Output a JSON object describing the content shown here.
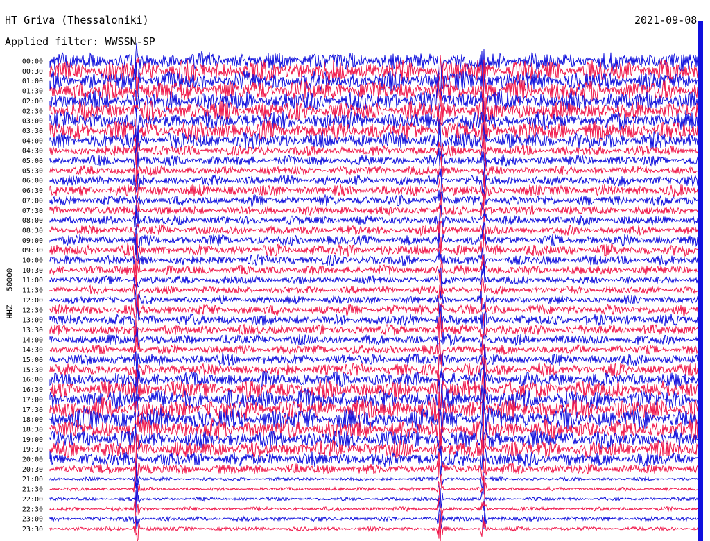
{
  "header": {
    "station": "HT Griva (Thessaloniki)",
    "date": "2021-09-08",
    "filter": "Applied filter: WWSSN-SP"
  },
  "channel_label": "HHZ - 50000",
  "colors": {
    "trace_a": "#1010dd",
    "trace_b": "#f0174a",
    "text": "#000000",
    "background": "#ffffff"
  },
  "chart_data": {
    "type": "line",
    "title": "HT Griva (Thessaloniki)",
    "ylabel": "HHZ - 50000",
    "xlabel": "",
    "rows": [
      "00:00",
      "00:30",
      "01:00",
      "01:30",
      "02:00",
      "02:30",
      "03:00",
      "03:30",
      "04:00",
      "04:30",
      "05:00",
      "05:30",
      "06:00",
      "06:30",
      "07:00",
      "07:30",
      "08:00",
      "08:30",
      "09:00",
      "09:30",
      "10:00",
      "10:30",
      "11:00",
      "11:30",
      "12:00",
      "12:30",
      "13:00",
      "13:30",
      "14:00",
      "14:30",
      "15:00",
      "15:30",
      "16:00",
      "16:30",
      "17:00",
      "17:30",
      "18:00",
      "18:30",
      "19:00",
      "19:30",
      "20:00",
      "20:30",
      "21:00",
      "21:30",
      "22:00",
      "22:30",
      "23:00",
      "23:30"
    ],
    "row_colors": [
      "trace_a",
      "trace_b"
    ],
    "noise_level_by_row": [
      0.8,
      0.95,
      0.85,
      0.95,
      0.9,
      0.85,
      0.8,
      0.85,
      0.75,
      0.45,
      0.45,
      0.4,
      0.45,
      0.5,
      0.45,
      0.4,
      0.4,
      0.4,
      0.45,
      0.5,
      0.45,
      0.4,
      0.35,
      0.35,
      0.35,
      0.45,
      0.5,
      0.45,
      0.45,
      0.4,
      0.5,
      0.55,
      0.65,
      0.8,
      0.9,
      0.95,
      0.95,
      0.9,
      0.8,
      0.75,
      0.65,
      0.45,
      0.15,
      0.15,
      0.15,
      0.18,
      0.2,
      0.18
    ],
    "spike_minutes_into_row": [
      4,
      18,
      20
    ],
    "grid": false
  }
}
